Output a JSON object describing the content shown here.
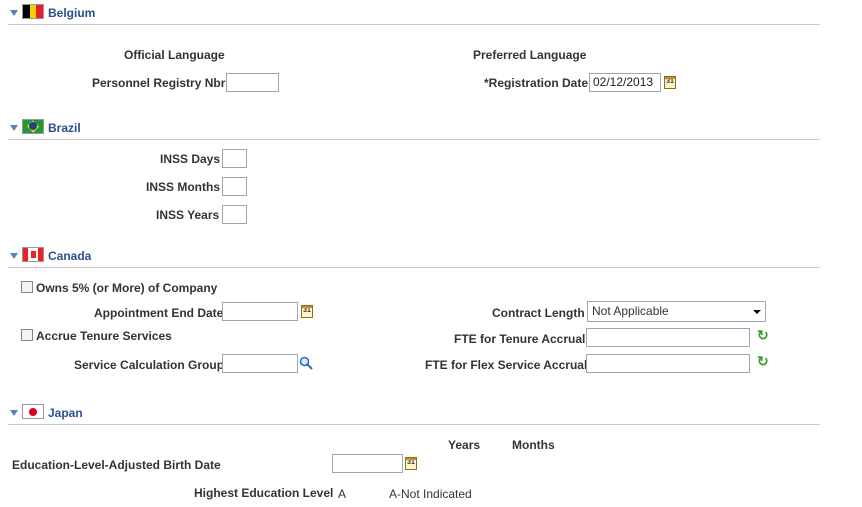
{
  "belgium": {
    "title": "Belgium",
    "official_language_label": "Official Language",
    "preferred_language_label": "Preferred Language",
    "personnel_registry_label": "Personnel Registry Nbr",
    "personnel_registry_value": "",
    "registration_date_label": "*Registration Date",
    "registration_date_value": "02/12/2013"
  },
  "brazil": {
    "title": "Brazil",
    "inss_days_label": "INSS Days",
    "inss_days_value": "",
    "inss_months_label": "INSS Months",
    "inss_months_value": "",
    "inss_years_label": "INSS Years",
    "inss_years_value": ""
  },
  "canada": {
    "title": "Canada",
    "owns_label": "Owns 5% (or More) of Company",
    "appointment_end_label": "Appointment End Date",
    "appointment_end_value": "",
    "contract_length_label": "Contract Length",
    "contract_length_value": "Not Applicable",
    "accrue_tenure_label": "Accrue Tenure Services",
    "fte_tenure_label": "FTE for Tenure Accrual",
    "fte_tenure_value": "",
    "service_calc_label": "Service Calculation Group",
    "service_calc_value": "",
    "fte_flex_label": "FTE for Flex Service Accrual",
    "fte_flex_value": ""
  },
  "japan": {
    "title": "Japan",
    "years_header": "Years",
    "months_header": "Months",
    "birth_date_label": "Education-Level-Adjusted Birth Date",
    "birth_date_value": "",
    "highest_edu_label": "Highest Education Level",
    "highest_edu_code": "A",
    "highest_edu_desc": "A-Not Indicated"
  },
  "icons": {
    "calendar": "calendar-icon",
    "lookup": "magnifier-icon",
    "refresh": "refresh-icon",
    "collapse": "collapse-triangle-icon"
  },
  "colors": {
    "section_title": "#2b4f8c",
    "refresh": "#3a9b2a"
  }
}
